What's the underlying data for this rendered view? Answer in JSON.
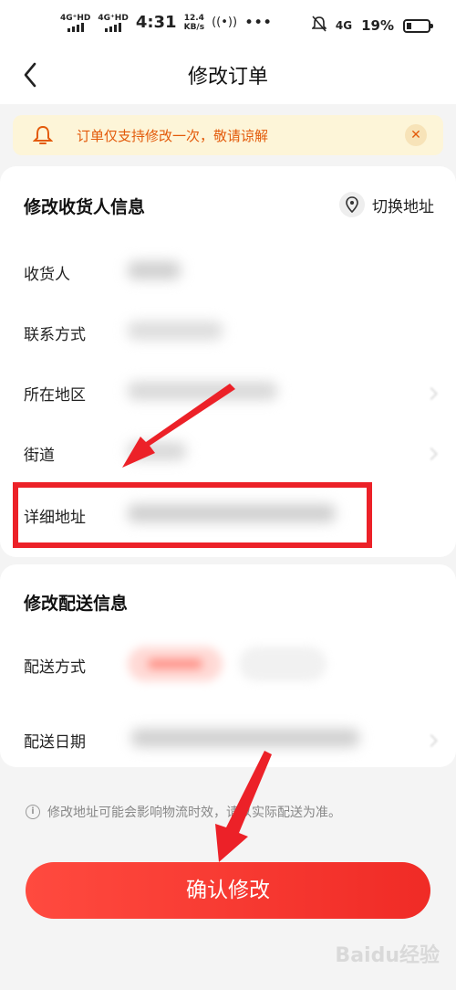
{
  "status_bar": {
    "signal1": "4G⁺HD",
    "signal2": "4G⁺HD",
    "time": "4:31",
    "speed_value": "12.4",
    "speed_unit": "KB/s",
    "dots": "•••",
    "network": "4G",
    "battery": "19%"
  },
  "nav": {
    "title": "修改订单"
  },
  "notice": {
    "text": "订单仅支持修改一次，敬请谅解",
    "close": "✕"
  },
  "receiver": {
    "title": "修改收货人信息",
    "switch_label": "切换地址",
    "rows": [
      {
        "label": "收货人"
      },
      {
        "label": "联系方式"
      },
      {
        "label": "所在地区"
      },
      {
        "label": "街道"
      },
      {
        "label": "详细地址"
      }
    ]
  },
  "delivery": {
    "title": "修改配送信息",
    "rows": [
      {
        "label": "配送方式"
      },
      {
        "label": "配送日期"
      }
    ]
  },
  "hint": {
    "icon": "i",
    "text": "修改地址可能会影响物流时效，请以实际配送为准。"
  },
  "confirm_button": "确认修改",
  "watermark": "Baidu经验",
  "colors": {
    "accent": "#f0302a",
    "notice_bg": "#fdf5d8",
    "notice_text": "#e35a0a",
    "annotation": "#ec2128"
  }
}
